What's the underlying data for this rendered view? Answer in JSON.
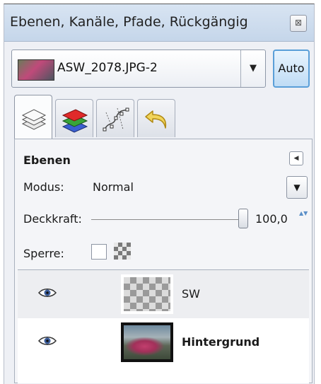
{
  "window": {
    "title": "Ebenen, Kanäle, Pfade, Rückgängig",
    "close_glyph": "⊠"
  },
  "image_selector": {
    "name": "ASW_2078.JPG-2",
    "dropdown_glyph": "▼",
    "auto_label": "Auto"
  },
  "tabs": [
    {
      "name": "layers",
      "icon": "layers-icon",
      "active": true
    },
    {
      "name": "channels",
      "icon": "channels-icon",
      "active": false
    },
    {
      "name": "paths",
      "icon": "paths-icon",
      "active": false
    },
    {
      "name": "undo",
      "icon": "undo-icon",
      "active": false
    }
  ],
  "layers_panel": {
    "heading": "Ebenen",
    "menu_glyph": "◀",
    "mode_label": "Modus:",
    "mode_value": "Normal",
    "mode_arrow": "▼",
    "opacity_label": "Deckkraft:",
    "opacity_value": "100,0",
    "opacity_fraction": 1.0,
    "spin_glyph": "▲▼",
    "lock_label": "Sperre:",
    "lock_checked": false
  },
  "layers": [
    {
      "name": "SW",
      "visible": true,
      "selected": true,
      "thumbnail": "transparent"
    },
    {
      "name": "Hintergrund",
      "visible": true,
      "selected": false,
      "thumbnail": "photo"
    }
  ],
  "colors": {
    "title_bg": "#d0deee",
    "auto_border": "#5a9fd8",
    "panel_bg": "#eef0f5"
  }
}
